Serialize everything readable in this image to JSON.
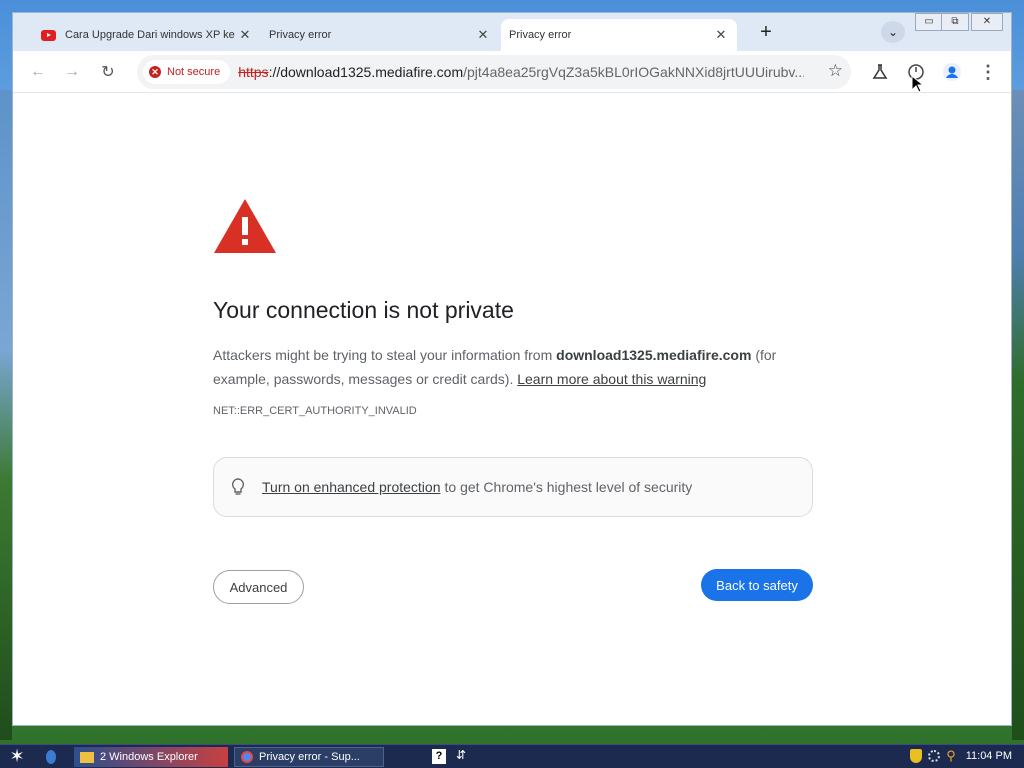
{
  "tabs": [
    {
      "label": "Cara Upgrade Dari windows XP ke",
      "icon": "youtube-icon"
    },
    {
      "label": "Privacy error",
      "icon": ""
    },
    {
      "label": "Privacy error",
      "icon": ""
    }
  ],
  "toolbar": {
    "security_chip": "Not secure",
    "url_scheme": "https",
    "url_host": "://download1325.mediafire.com",
    "url_path": "/pjt4a8ea25rgVqZ3a5kBL0rIOGakNNXid8jrtUUUirubv..."
  },
  "page": {
    "title": "Your connection is not private",
    "desc_prefix": "Attackers might be trying to steal your information from ",
    "desc_host": "download1325.mediafire.com",
    "desc_suffix": " (for example, passwords, messages or credit cards). ",
    "learn_more": "Learn more about this warning",
    "error_code": "NET::ERR_CERT_AUTHORITY_INVALID",
    "protection_link": "Turn on enhanced protection",
    "protection_text": " to get Chrome's highest level of security",
    "advanced_label": "Advanced",
    "safety_label": "Back to safety"
  },
  "taskbar": {
    "explorer_label": "2 Windows Explorer",
    "privacy_label": "Privacy error - Sup...",
    "clock": "11:04 PM",
    "help_glyph": "?"
  },
  "colors": {
    "warning_red": "#d93025",
    "primary_blue": "#1a73e8",
    "not_secure_red": "#c5221f"
  }
}
